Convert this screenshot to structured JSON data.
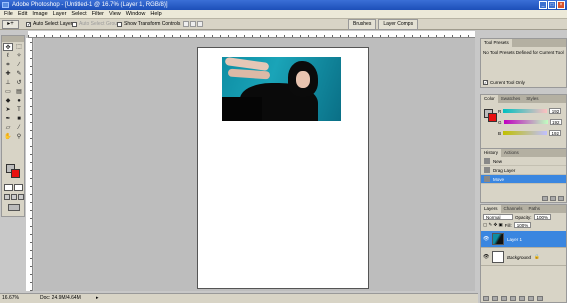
{
  "app": {
    "title": "Adobe Photoshop - [Untitled-1 @ 16.7% (Layer 1, RGB/8)]"
  },
  "menu": [
    "File",
    "Edit",
    "Image",
    "Layer",
    "Select",
    "Filter",
    "View",
    "Window",
    "Help"
  ],
  "options": {
    "auto_select_layer": "Auto Select Layer",
    "auto_select_groups": "Auto Select Groups",
    "show_transform_controls": "Show Transform Controls"
  },
  "palette_well": {
    "tabs": [
      "Brushes",
      "Layer Comps"
    ]
  },
  "status": {
    "zoom": "16.67%",
    "doc": "Doc: 24.9M/4.64M"
  },
  "panels": {
    "tool_presets": {
      "tab": "Tool Presets",
      "message": "No Tool Presets Defined for Current Tool",
      "current_tool_only": "Current Tool Only"
    },
    "color": {
      "tabs": [
        "Color",
        "Swatches",
        "Styles"
      ],
      "channels": [
        {
          "label": "R",
          "value": "192"
        },
        {
          "label": "G",
          "value": "192"
        },
        {
          "label": "B",
          "value": "192"
        }
      ]
    },
    "history": {
      "tabs": [
        "History",
        "Actions"
      ],
      "items": [
        "New",
        "Drag Layer",
        "Move"
      ]
    },
    "layers": {
      "tabs": [
        "Layers",
        "Channels",
        "Paths"
      ],
      "blend_mode": "Normal",
      "opacity_label": "Opacity:",
      "opacity_value": "100%",
      "fill_label": "Fill:",
      "fill_value": "100%",
      "items": [
        "Layer 1",
        "Background"
      ]
    }
  },
  "colors": {
    "foreground": "#bdbdbd",
    "background": "#e81010",
    "selection": "#3a86e0"
  }
}
